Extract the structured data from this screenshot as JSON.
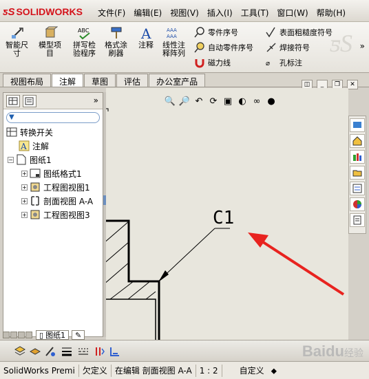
{
  "app": {
    "logo_text": "SOLIDWORKS"
  },
  "menu": [
    "文件(F)",
    "编辑(E)",
    "视图(V)",
    "插入(I)",
    "工具(T)",
    "窗口(W)",
    "帮助(H)"
  ],
  "ribbon": {
    "big": [
      {
        "label1": "智能尺",
        "label2": "寸"
      },
      {
        "label1": "模型项",
        "label2": "目"
      },
      {
        "label1": "拼写检",
        "label2": "验程序"
      },
      {
        "label1": "格式涂",
        "label2": "刷器"
      },
      {
        "label1": "注释",
        "label2": ""
      },
      {
        "label1": "线性注",
        "label2": "释阵列"
      }
    ],
    "small": [
      "零件序号",
      "自动零件序号",
      "磁力线",
      "表面粗糙度符号",
      "焊接符号",
      "孔标注"
    ],
    "more": "»"
  },
  "tabs": [
    "视图布局",
    "注解",
    "草图",
    "评估",
    "办公室产品"
  ],
  "tree": {
    "collapse": "»",
    "items": [
      "转换开关",
      "注解",
      "图纸1",
      "图纸格式1",
      "工程图视图1",
      "剖面视图 A-A",
      "工程图视图3"
    ]
  },
  "sheet_tab": "图纸1",
  "drawing": {
    "chamfer_label": "C1"
  },
  "status": [
    "SolidWorks Premi",
    "欠定义",
    "在编辑 剖面视图 A-A",
    "1 : 2",
    "自定义"
  ],
  "watermark": {
    "brand": "Baidu",
    "sub": "经验"
  },
  "colors": {
    "arrow": "#e8231f",
    "brand_red": "#d4121a"
  }
}
